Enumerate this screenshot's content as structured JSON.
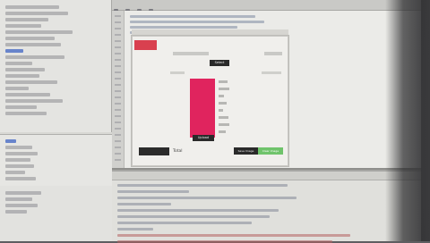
{
  "app": {
    "select_button_label": "Select",
    "upload_button_label": "Upload",
    "total_label": "Total",
    "save_button_label": "Save Image",
    "clear_button_label": "Clear Image"
  },
  "colors": {
    "accent_red": "#d9404f",
    "bar_pink": "#e0245e",
    "button_green": "#6fc36b",
    "button_dark": "#2a2a2a"
  }
}
